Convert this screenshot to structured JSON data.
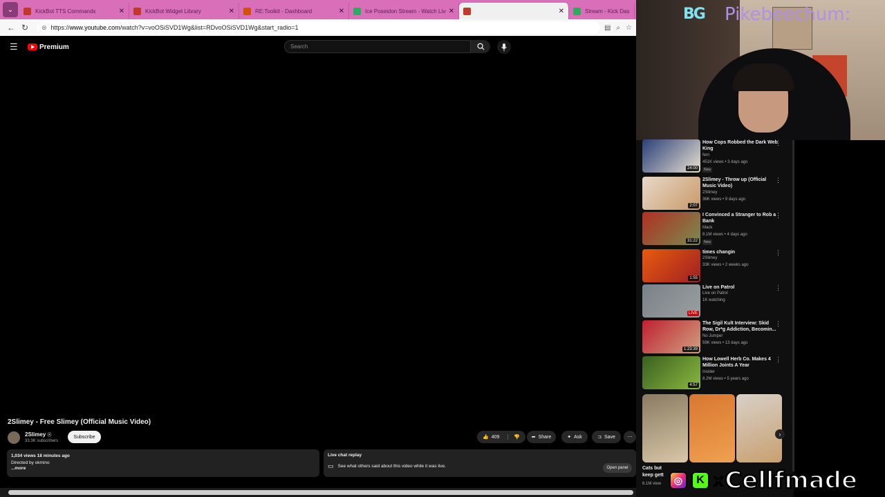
{
  "browser": {
    "tabs": [
      {
        "label": "KickBot TTS Commands",
        "color": "#c0392b"
      },
      {
        "label": "KickBot Widget Library",
        "color": "#c0392b"
      },
      {
        "label": "RE:Toolkit - Dashboard",
        "color": "#d35400"
      },
      {
        "label": "Ice Poseidon Stream - Watch Live",
        "color": "#27ae60"
      },
      {
        "label": "",
        "color": "#c0392b"
      },
      {
        "label": "Stream - Kick Dashbo",
        "color": "#27ae60"
      }
    ],
    "url_prefix": "https://",
    "url_host": "www.youtube.com",
    "url_path": "/watch?v=voOSiSVD1Wg&list=RDvoOSiSVD1Wg&start_radio=1"
  },
  "youtube": {
    "logo_text": "Premium",
    "search_placeholder": "Search",
    "video_title": "2Slimey - Free Slimey (Official Music Video)",
    "channel_name": "2Slimey",
    "subscribers": "33.3K subscribers",
    "subscribe_label": "Subscribe",
    "likes": "409",
    "share_label": "Share",
    "ask_label": "Ask",
    "save_label": "Save",
    "description": {
      "stats": "1,034 views  18 minutes ago",
      "line2": "Directed by okmino",
      "more": "...more"
    },
    "live_chat": {
      "title": "Live chat replay",
      "text": "See what others said about this video while it was live.",
      "button": "Open panel"
    },
    "recommendations": [
      {
        "title": "How Cops Robbed the Dark Web King",
        "channel": "fern",
        "meta": "451K views • 3 days ago",
        "badge": "New",
        "duration": "24:00",
        "colors": [
          "#2a3f7a",
          "#e8e0d0"
        ]
      },
      {
        "title": "2Slimey - Throw up (Official Music Video)",
        "channel": "2Slimey",
        "meta": "36K views • 9 days ago",
        "badge": "",
        "duration": "2:07",
        "colors": [
          "#e8d8c8",
          "#c99a6a"
        ]
      },
      {
        "title": "I Convinced a Stranger to Rob a Bank",
        "channel": "Mack",
        "meta": "8.1M views • 4 days ago",
        "badge": "New",
        "duration": "31:22",
        "colors": [
          "#b03020",
          "#7a8a50"
        ]
      },
      {
        "title": "times changin",
        "channel": "2Slimey",
        "meta": "33K views • 2 weeks ago",
        "badge": "",
        "duration": "1:55",
        "colors": [
          "#e85a10",
          "#a02020"
        ]
      },
      {
        "title": "Live on Patrol",
        "channel": "Live on Patrol",
        "meta": "1K watching",
        "badge": "",
        "duration": "LIVE",
        "colors": [
          "#7a8088",
          "#9aa0a0"
        ]
      },
      {
        "title": "The Sigil Kult Interview: Skid Row, Dr*g Addiction, Becomin...",
        "channel": "No Jumper",
        "meta": "59K views • 13 days ago",
        "badge": "",
        "duration": "1:23:39",
        "colors": [
          "#c02030",
          "#d0a080"
        ]
      },
      {
        "title": "How Lowell Herb Co. Makes 4 Million Joints A Year",
        "channel": "Insider",
        "meta": "8.2M views • 5 years ago",
        "badge": "",
        "duration": "4:57",
        "colors": [
          "#3a6020",
          "#8ab840"
        ]
      }
    ],
    "shorts": [
      {
        "colors": [
          "#8a7a60",
          "#d8c8a8"
        ]
      },
      {
        "colors": [
          "#d87830",
          "#f0a050"
        ]
      },
      {
        "colors": [
          "#d8d0c8",
          "#c8a070"
        ]
      }
    ],
    "shorts_caption": "Cats but keep gett",
    "shorts_meta": "6.1M view"
  },
  "stream": {
    "cam_name": "Pikebeechum:",
    "cam_logo": "BG",
    "overlay_name": "Cellfmade",
    "overlay_x": "x",
    "overlay_kick": "K"
  },
  "colors": {
    "tab_bg": "#d96fb9",
    "accent_red": "#ff0000"
  }
}
